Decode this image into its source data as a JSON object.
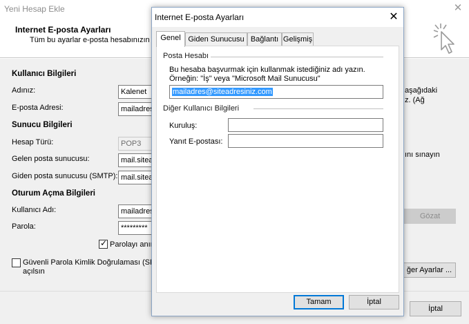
{
  "background_window": {
    "title": "Yeni Hesap Ekle",
    "header": {
      "title": "Internet E-posta Ayarları",
      "subtitle": "Tüm bu ayarlar e-posta hesabınızın ç"
    },
    "user_info": {
      "section": "Kullanıcı Bilgileri",
      "name_label": "Adınız:",
      "name_value": "Kalenet",
      "email_label": "E-posta Adresi:",
      "email_value": "mailadres"
    },
    "server_info": {
      "section": "Sunucu Bilgileri",
      "account_type_label": "Hesap Türü:",
      "account_type_value": "POP3",
      "incoming_label": "Gelen posta sunucusu:",
      "incoming_value": "mail.sitea",
      "outgoing_label": "Giden posta sunucusu (SMTP):",
      "outgoing_value": "mail.sitea"
    },
    "logon_info": {
      "section": "Oturum Açma Bilgileri",
      "username_label": "Kullanıcı Adı:",
      "username_value": "mailadres",
      "password_label": "Parola:",
      "password_value": "*********",
      "remember_password_label": "Parolayı anım",
      "remember_password_checked": true,
      "spa_label_line1": "Güvenli Parola Kimlik Doğrulaması (SPA)",
      "spa_label_line2": "açılsın",
      "spa_checked": false
    },
    "right_panel": {
      "text_line1": "aşağıdaki",
      "text_line2": "z. (Ağ",
      "test_text": "ını sınayın",
      "browse_button": "Gözat",
      "more_settings_button": "ğer Ayarlar ..."
    },
    "footer": {
      "cancel_button": "İptal"
    }
  },
  "dialog": {
    "title": "Internet E-posta Ayarları",
    "tabs": [
      {
        "label": "Genel",
        "active": true
      },
      {
        "label": "Giden Sunucusu",
        "active": false
      },
      {
        "label": "Bağlantı",
        "active": false
      },
      {
        "label": "Gelişmiş",
        "active": false
      }
    ],
    "mail_account": {
      "group_title": "Posta Hesabı",
      "description_line1": "Bu hesaba başvurmak için kullanmak istediğiniz adı yazın.",
      "description_line2": "Örneğin: \"İş\" veya \"Microsoft Mail Sunucusu\"",
      "account_name_value": "mailadres@siteadresiniz.com"
    },
    "other_user_info": {
      "group_title": "Diğer Kullanıcı Bilgileri",
      "organization_label": "Kuruluş:",
      "organization_value": "",
      "reply_email_label": "Yanıt E-postası:",
      "reply_email_value": ""
    },
    "buttons": {
      "ok": "Tamam",
      "cancel": "İptal"
    }
  },
  "colors": {
    "selection": "#3399ff",
    "default_button_border": "#0078d7",
    "dialog_border": "#8aa4c4"
  },
  "icons": [
    "close-icon",
    "wizard-cursor-icon",
    "checkbox-checked",
    "checkbox-unchecked"
  ]
}
